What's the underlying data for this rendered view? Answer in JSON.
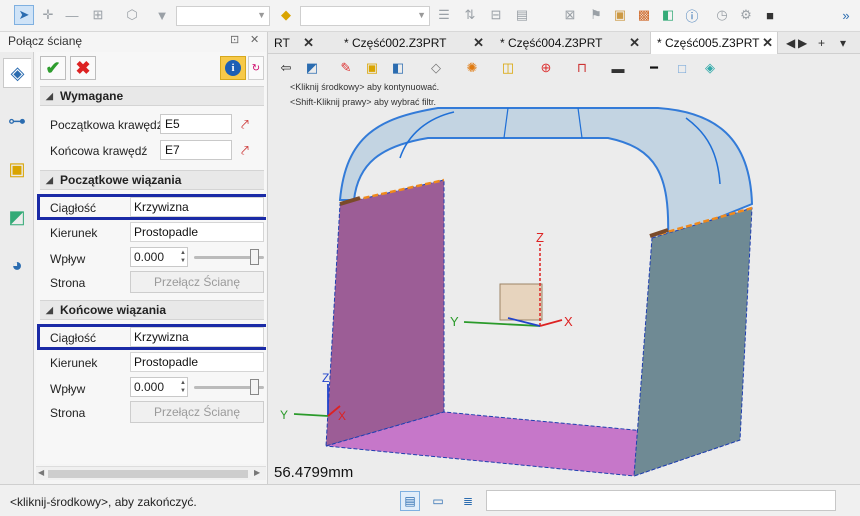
{
  "toolbar": {
    "icons": [
      "pointer-icon",
      "move-icon",
      "minus-icon",
      "grid-snap-icon",
      "polygon-icon",
      "filter-icon",
      "view-orient-icon",
      "align-icon",
      "sort-icon",
      "measure-icon",
      "layers-icon",
      "tag-icon",
      "folder-icon",
      "chip-icon",
      "info-icon",
      "history-icon",
      "stop-icon"
    ],
    "filter_value": "",
    "view_value": ""
  },
  "panel": {
    "title": "Połącz ścianę",
    "ctrl_pin": "⊡",
    "ctrl_close": "✕",
    "required": {
      "header": "Wymagane",
      "start_edge_label": "Początkowa krawędź",
      "start_edge_value": "E5",
      "end_edge_label": "Końcowa krawędź",
      "end_edge_value": "E7"
    },
    "start_constraints": {
      "header": "Początkowe wiązania",
      "continuity_label": "Ciągłość",
      "continuity_value": "Krzywizna",
      "direction_label": "Kierunek",
      "direction_value": "Prostopadle",
      "influence_label": "Wpływ",
      "influence_value": "0.000",
      "influence_level": 0.85,
      "side_label": "Strona",
      "side_button": "Przełącz Ścianę"
    },
    "end_constraints": {
      "header": "Końcowe wiązania",
      "continuity_label": "Ciągłość",
      "continuity_value": "Krzywizna",
      "direction_label": "Kierunek",
      "direction_value": "Prostopadle",
      "influence_label": "Wpływ",
      "influence_value": "0.000",
      "influence_level": 0.85,
      "side_label": "Strona",
      "side_button": "Przełącz Ścianę"
    }
  },
  "tabs": [
    {
      "label": "RT"
    },
    {
      "label": "* Część002.Z3PRT"
    },
    {
      "label": "* Część004.Z3PRT"
    },
    {
      "label": "* Część005.Z3PRT",
      "active": true
    }
  ],
  "viewport": {
    "hint_line1": "<Kliknij środkowy> aby kontynuować.",
    "hint_line2": "<Shift-Kliknij prawy> aby wybrać filtr.",
    "measurement": "56.4799mm",
    "axes": {
      "x": "X",
      "y": "Y",
      "z": "Z"
    },
    "colors": {
      "left_face": "#9c5d96",
      "right_face": "#6f8a94",
      "bottom_face": "#c677c9",
      "top_surface": "#bfd2e2",
      "edge": "#1f6fd6",
      "constraint_edge": "#f08a1d"
    }
  },
  "status": {
    "text": "<kliknij-środkowy>, aby zakończyć.",
    "command_value": ""
  }
}
